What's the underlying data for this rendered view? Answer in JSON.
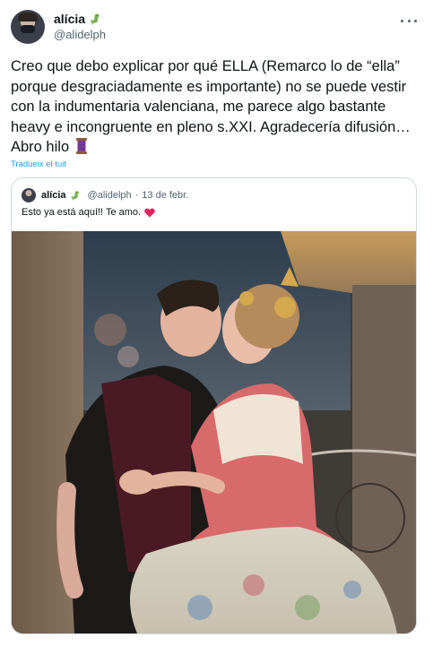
{
  "tweet": {
    "author_name": "alícia",
    "author_handle": "@alidelph",
    "text": "Creo que debo explicar por qué ELLA (Remarco lo de “ella” porque desgraciadamente es importante) no se puede vestir con la indumentaria valenciana, me parece algo bastante heavy e incongruente en pleno s.XXI. Agradecería difusión… Abro hilo",
    "translate_label": "Tradueix el tuit",
    "accent_color": "#1d9bf0"
  },
  "quoted_tweet": {
    "author_name": "alícia",
    "author_handle": "@alidelph",
    "separator": "·",
    "date": "13 de febr.",
    "text": "Esto ya está aquí!! Te amo.",
    "heart_color": "#e0245e"
  },
  "icons": {
    "more": "more-horizontal-icon",
    "author_emoji": "dinosaur-icon",
    "thread_emoji": "thread-spool-icon",
    "heart_emoji": "heart-icon"
  }
}
